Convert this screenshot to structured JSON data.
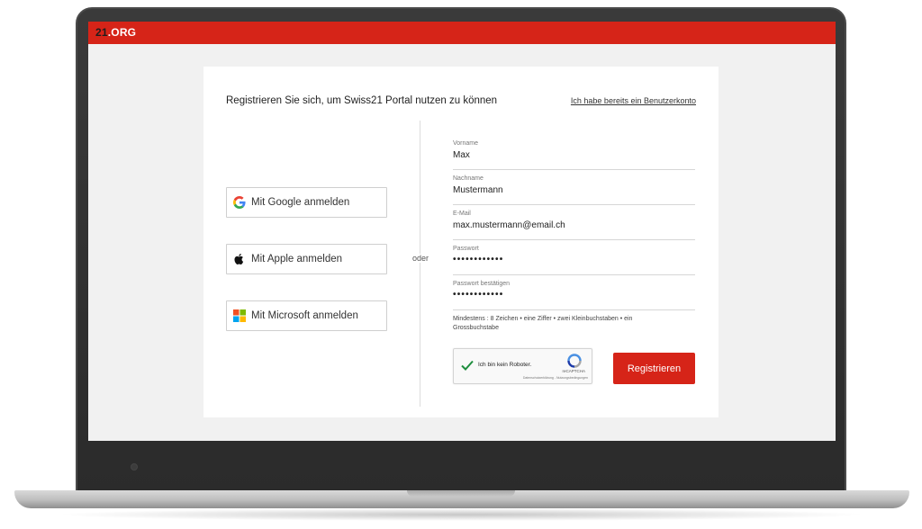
{
  "app": {
    "logo_number": "21",
    "logo_suffix": ".ORG",
    "brand_color": "#d62418"
  },
  "card": {
    "title": "Registrieren Sie sich, um Swiss21 Portal nutzen zu können",
    "login_link": "Ich habe bereits ein Benutzerkonto"
  },
  "social": [
    {
      "label": "Mit Google anmelden",
      "icon": "google-icon"
    },
    {
      "label": "Mit Apple anmelden",
      "icon": "apple-icon"
    },
    {
      "label": "Mit Microsoft anmelden",
      "icon": "microsoft-icon"
    }
  ],
  "divider": "oder",
  "fields": [
    {
      "label": "Vorname",
      "value": "Max"
    },
    {
      "label": "Nachname",
      "value": "Mustermann"
    },
    {
      "label": "E-Mail",
      "value": "max.mustermann@email.ch"
    },
    {
      "label": "Passwort",
      "value": "••••••••••••"
    },
    {
      "label": "Passwort bestätigen",
      "value": "••••••••••••"
    }
  ],
  "password_hint": "Mindestens : 8 Zeichen • eine Ziffer • zwei Kleinbuchstaben • ein Grossbuchstabe",
  "captcha": {
    "label": "Ich bin kein Roboter.",
    "brand": "reCAPTCHA",
    "terms": "Datenschutzerklärung - Nutzungsbedingungen",
    "checked": true
  },
  "register_button": "Registrieren"
}
